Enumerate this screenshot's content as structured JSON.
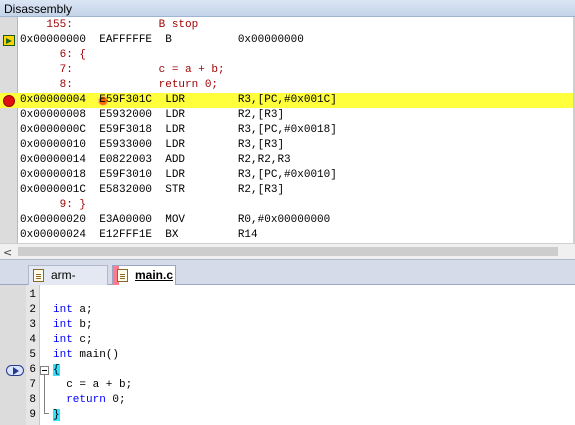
{
  "disassembly": {
    "title": "Disassembly",
    "lines": [
      {
        "text": "    155:             B stop",
        "kind": "src"
      },
      {
        "text": "0x00000000  EAFFFFFE  B          0x00000000",
        "kind": "asm",
        "marker": "arrow"
      },
      {
        "text": "      6: {",
        "kind": "src"
      },
      {
        "text": "      7:             c = a + b;",
        "kind": "src"
      },
      {
        "text": "      8:             return 0;",
        "kind": "src"
      },
      {
        "text": "0x00000004  E59F301C  LDR        R3,[PC,#0x001C]",
        "kind": "asm",
        "marker": "breakpoint",
        "highlight": true
      },
      {
        "text": "0x00000008  E5932000  LDR        R2,[R3]",
        "kind": "asm"
      },
      {
        "text": "0x0000000C  E59F3018  LDR        R3,[PC,#0x0018]",
        "kind": "asm"
      },
      {
        "text": "0x00000010  E5933000  LDR        R3,[R3]",
        "kind": "asm"
      },
      {
        "text": "0x00000014  E0822003  ADD        R2,R2,R3",
        "kind": "asm"
      },
      {
        "text": "0x00000018  E59F3010  LDR        R3,[PC,#0x0010]",
        "kind": "asm"
      },
      {
        "text": "0x0000001C  E5832000  STR        R2,[R3]",
        "kind": "asm"
      },
      {
        "text": "      9: }",
        "kind": "src"
      },
      {
        "text": "0x00000020  E3A00000  MOV        R0,#0x00000000",
        "kind": "asm"
      },
      {
        "text": "0x00000024  E12FFF1E  BX         R14",
        "kind": "asm"
      }
    ]
  },
  "tabs": [
    {
      "label": "arm-asm.s",
      "active": false
    },
    {
      "label": "main.c",
      "active": true
    }
  ],
  "editor": {
    "lines": [
      {
        "num": "1",
        "code": ""
      },
      {
        "num": "2",
        "kw": "int",
        "rest": " a;"
      },
      {
        "num": "3",
        "kw": "int",
        "rest": " b;"
      },
      {
        "num": "4",
        "kw": "int",
        "rest": " c;"
      },
      {
        "num": "5",
        "kw": "int",
        "rest": " main()"
      },
      {
        "num": "6",
        "code": "{"
      },
      {
        "num": "7",
        "code": "  c = a + b;"
      },
      {
        "num": "8",
        "kw": "  return",
        "rest": " 0;"
      },
      {
        "num": "9",
        "code": "}"
      }
    ]
  },
  "colors": {
    "highlight": "#ffff3c",
    "breakpoint": "#e01010",
    "source_text": "#9c0000",
    "keyword": "#0000ff",
    "brace_match": "#33e0ff"
  }
}
